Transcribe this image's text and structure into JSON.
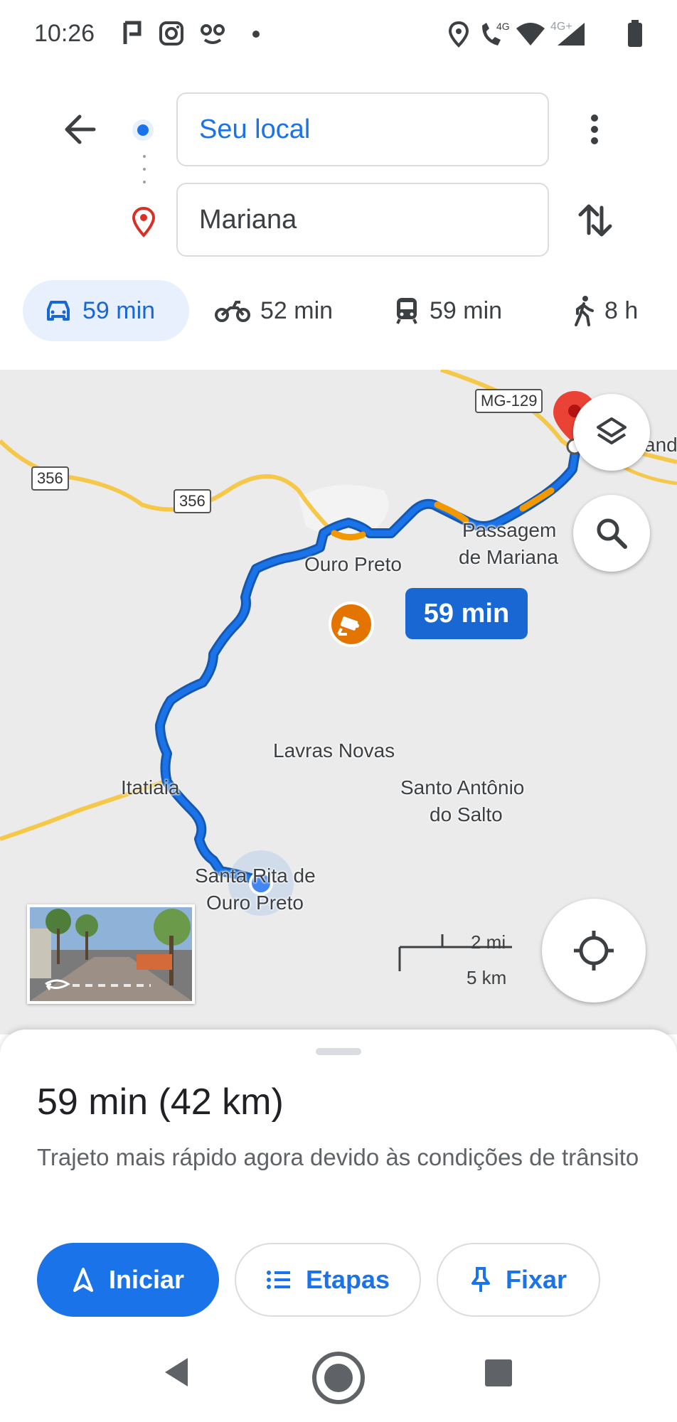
{
  "status_bar": {
    "time": "10:26",
    "left_icons": [
      "flag-icon",
      "instagram-icon",
      "voicemail-icon",
      "dot-icon"
    ],
    "right_icons": [
      "location-icon",
      "volte-call-icon",
      "wifi-icon",
      "signal-icon",
      "battery-icon"
    ],
    "network_label_1": "4G",
    "network_label_2": "4G+"
  },
  "directions": {
    "origin": "Seu local",
    "destination": "Mariana"
  },
  "modes": [
    {
      "icon": "car-icon",
      "label": "59 min",
      "selected": true
    },
    {
      "icon": "motorcycle-icon",
      "label": "52 min",
      "selected": false
    },
    {
      "icon": "transit-icon",
      "label": "59 min",
      "selected": false
    },
    {
      "icon": "walk-icon",
      "label": "8 h",
      "selected": false
    }
  ],
  "map": {
    "labels": {
      "mg129": "MG-129",
      "br356a": "356",
      "br356b": "356",
      "ouro_preto": "Ouro Preto",
      "passagem": "Passagem",
      "de_mariana": "de Mariana",
      "lavras_novas": "Lavras Novas",
      "itatiaia": "Itatiaia",
      "santo_antonio_1": "Santo Antônio",
      "santo_antonio_2": "do Salto",
      "santa_rita_1": "Santa Rita de",
      "santa_rita_2": "Ouro Preto",
      "edge_label": "and"
    },
    "route_time": "59 min",
    "scale_mi": "2 mi",
    "scale_km": "5 km",
    "colors": {
      "route": "#1a73e8",
      "traffic": "#f29900",
      "road": "#f6c84a"
    }
  },
  "sheet": {
    "summary": "59 min (42 km)",
    "description": "Trajeto mais rápido agora devido às condições de trânsito",
    "start_label": "Iniciar",
    "steps_label": "Etapas",
    "pin_label": "Fixar"
  }
}
